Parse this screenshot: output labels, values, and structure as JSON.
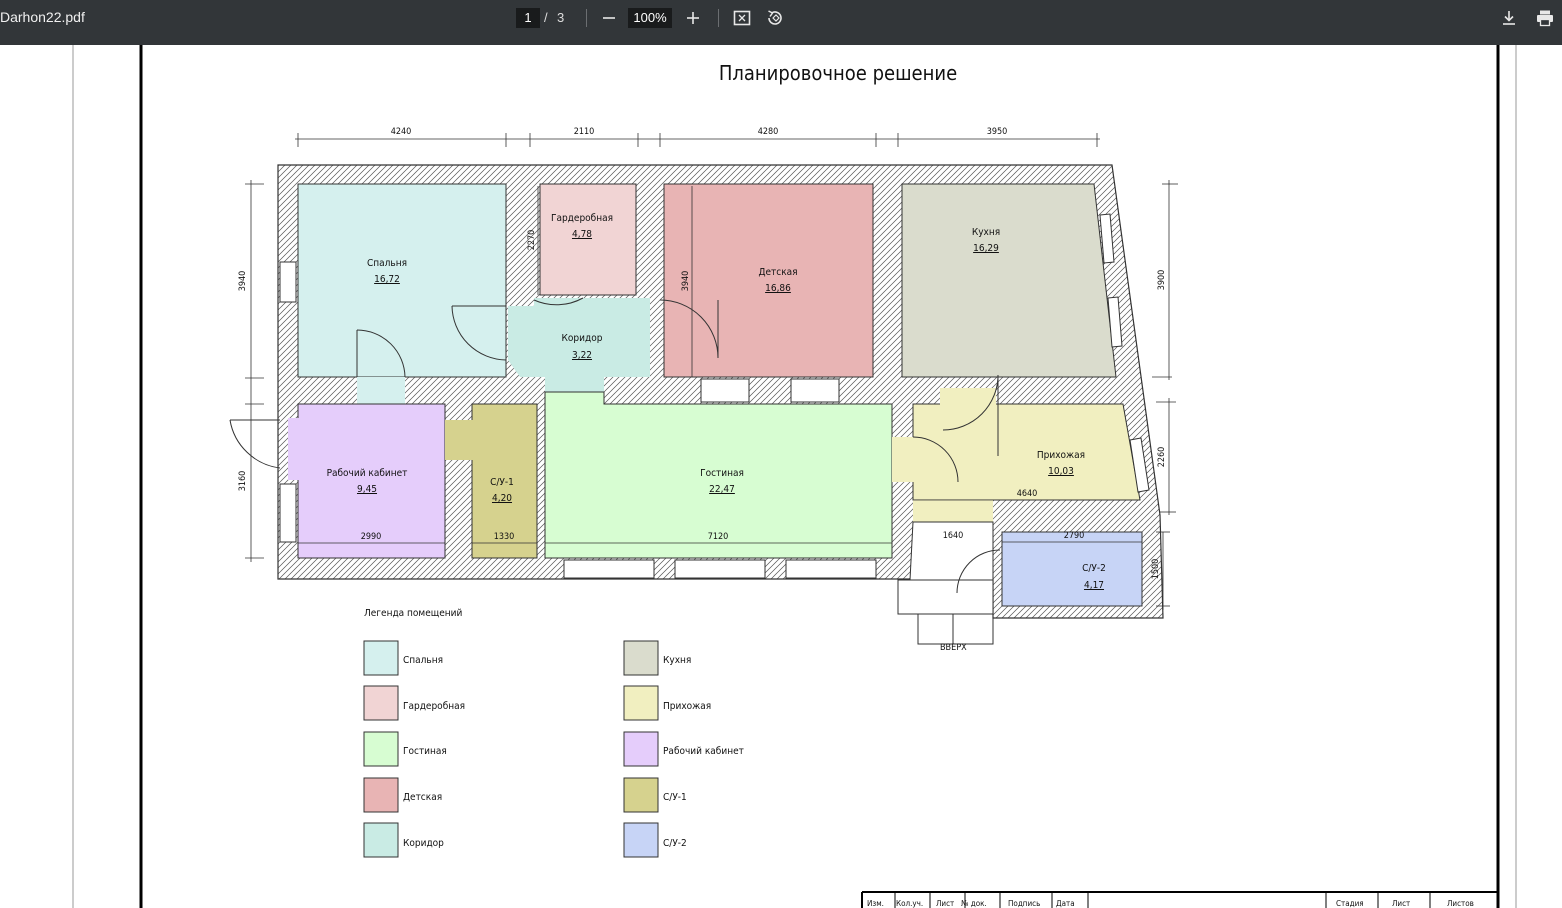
{
  "viewer": {
    "filename": "Darhon22.pdf",
    "current_page": "1",
    "page_separator": "/",
    "total_pages": "3",
    "zoom": "100%",
    "icons": [
      "minus-icon",
      "plus-icon",
      "fit-page-icon",
      "rotate-icon",
      "download-icon",
      "print-icon"
    ]
  },
  "drawing": {
    "title": "Планировочное решение",
    "rooms": {
      "bedroom": {
        "name": "Спальня",
        "area": "16,72"
      },
      "wardrobe": {
        "name": "Гардеробная",
        "area": "4,78"
      },
      "nursery": {
        "name": "Детская",
        "area": "16,86"
      },
      "kitchen": {
        "name": "Кухня",
        "area": "16,29"
      },
      "corridor": {
        "name": "Коридор",
        "area": "3,22"
      },
      "office": {
        "name": "Рабочий кабинет",
        "area": "9,45"
      },
      "bath1": {
        "name": "С/У-1",
        "area": "4,20"
      },
      "living": {
        "name": "Гостиная",
        "area": "22,47"
      },
      "hall": {
        "name": "Прихожая",
        "area": "10,03"
      },
      "bath2": {
        "name": "С/У-2",
        "area": "4,17"
      }
    },
    "dims_top": [
      "4240",
      "2110",
      "4280",
      "3950"
    ],
    "dims_left": [
      "3940",
      "3160"
    ],
    "dims_right": [
      "3900",
      "2260",
      "1500"
    ],
    "dims_inner": {
      "wardrobe_h": "2270",
      "nursery_h": "3940",
      "office_w": "2990",
      "bath1_w": "1330",
      "living_w": "7120",
      "hall_w": "4640",
      "vest_w": "1640",
      "bath2_w": "2790"
    },
    "stair_label": "ВВЕРХ",
    "legend": {
      "title": "Легенда помещений",
      "items": [
        {
          "name": "Спальня",
          "color": "#d5f0ee"
        },
        {
          "name": "Гардеробная",
          "color": "#f1d4d4"
        },
        {
          "name": "Гостиная",
          "color": "#d7fdd2"
        },
        {
          "name": "Детская",
          "color": "#e8b4b4"
        },
        {
          "name": "Коридор",
          "color": "#c9ebe4"
        },
        {
          "name": "Кухня",
          "color": "#dadccd"
        },
        {
          "name": "Прихожая",
          "color": "#f1efc0"
        },
        {
          "name": "Рабочий кабинет",
          "color": "#e5cdfb"
        },
        {
          "name": "С/У-1",
          "color": "#d6d28e"
        },
        {
          "name": "С/У-2",
          "color": "#c7d4f6"
        }
      ]
    },
    "stamp": [
      "Изм.",
      "Кол.уч.",
      "Лист",
      "№ док.",
      "Подпись",
      "Дата",
      "Стадия",
      "Лист",
      "Листов"
    ]
  }
}
